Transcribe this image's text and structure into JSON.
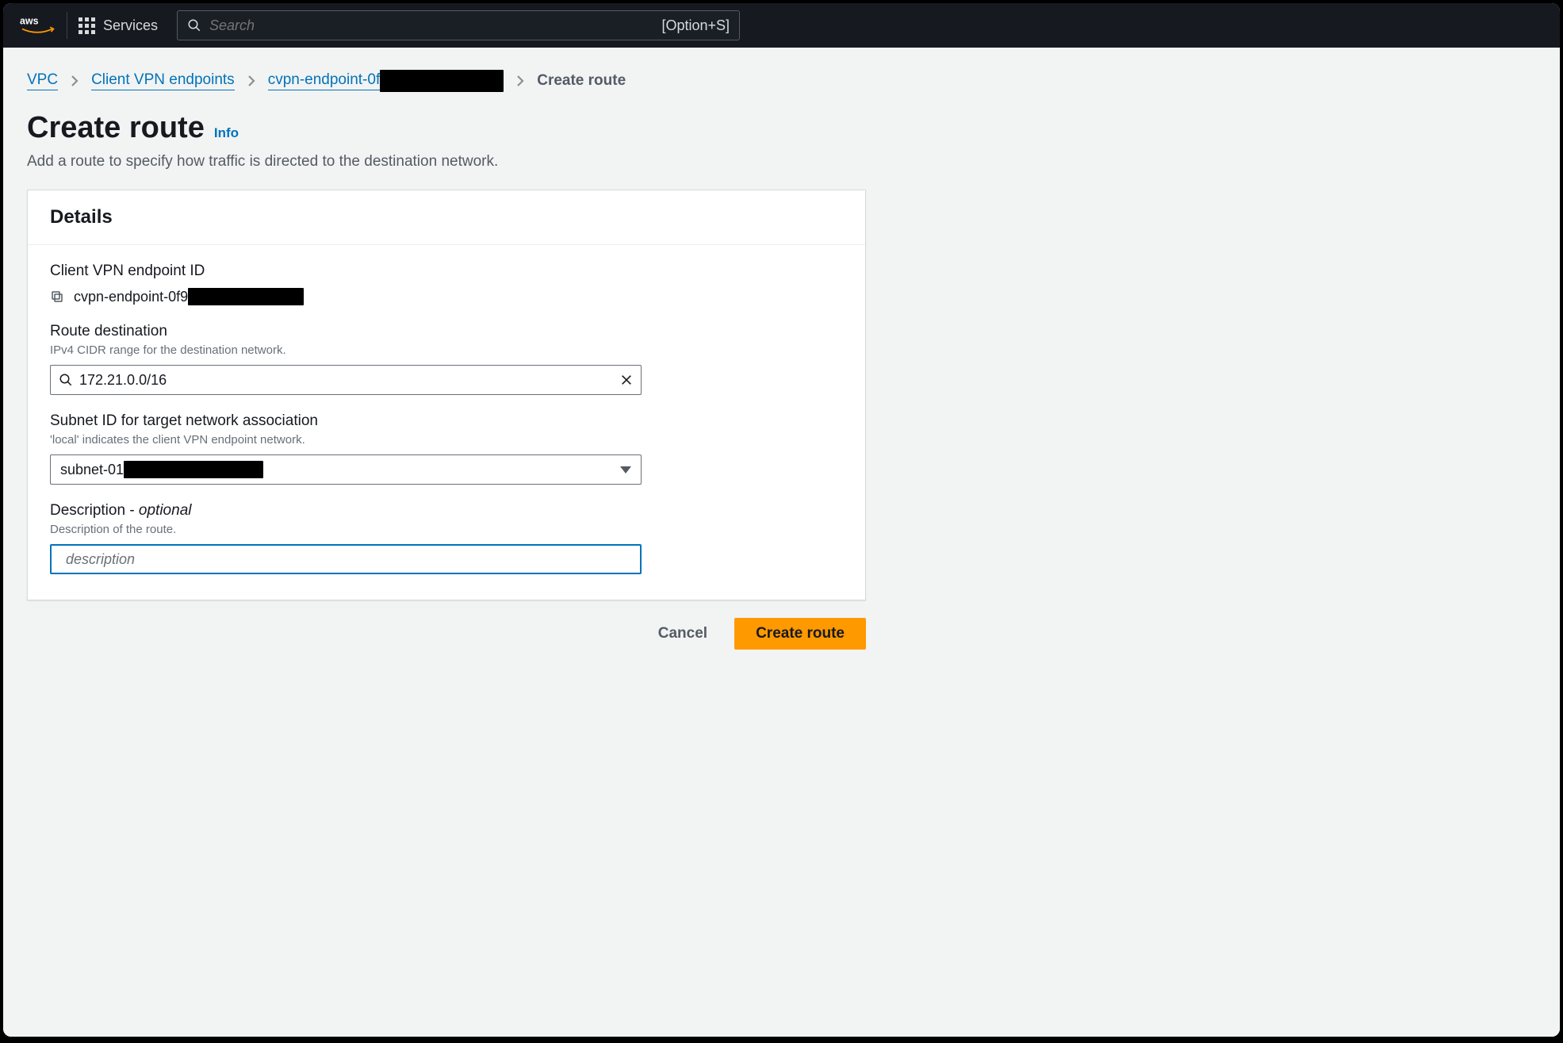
{
  "nav": {
    "services_label": "Services",
    "search_placeholder": "Search",
    "search_hint": "[Option+S]"
  },
  "breadcrumbs": {
    "items": [
      {
        "label": "VPC"
      },
      {
        "label": "Client VPN endpoints"
      },
      {
        "label_prefix": "cvpn-endpoint-0f"
      },
      {
        "label": "Create route"
      }
    ]
  },
  "page": {
    "title": "Create route",
    "info_label": "Info",
    "subtitle": "Add a route to specify how traffic is directed to the destination network."
  },
  "panel": {
    "title": "Details"
  },
  "fields": {
    "endpoint_id": {
      "label": "Client VPN endpoint ID",
      "value_prefix": "cvpn-endpoint-0f9"
    },
    "route_destination": {
      "label": "Route destination",
      "help": "IPv4 CIDR range for the destination network.",
      "value": "172.21.0.0/16"
    },
    "subnet_id": {
      "label": "Subnet ID for target network association",
      "help": "'local' indicates the client VPN endpoint network.",
      "value_prefix": "subnet-01"
    },
    "description": {
      "label_main": "Description - ",
      "label_optional": "optional",
      "help": "Description of the route.",
      "placeholder": "description",
      "value": ""
    }
  },
  "actions": {
    "cancel": "Cancel",
    "submit": "Create route"
  }
}
